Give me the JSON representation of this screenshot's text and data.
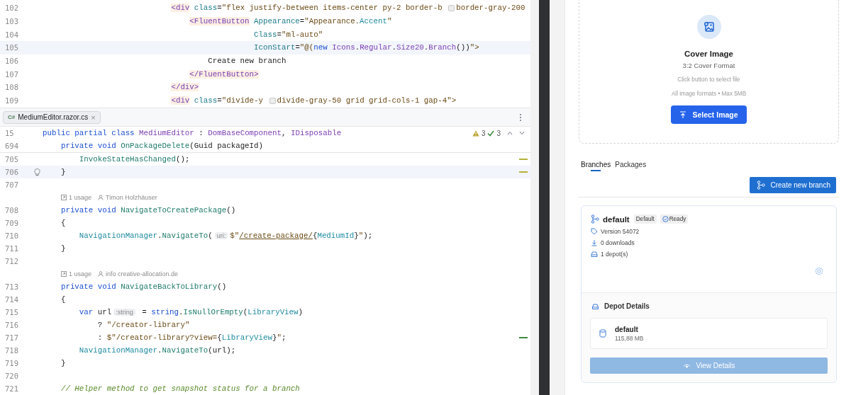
{
  "top_pane": {
    "lines": [
      {
        "number": "102",
        "current": false,
        "tokens": [
          {
            "kind": "tag",
            "text": "                            <div"
          },
          {
            "kind": "attr",
            "text": " class"
          },
          {
            "kind": "plain",
            "text": "="
          },
          {
            "kind": "str",
            "text": "\"flex justify-between items-center py-2 border-b "
          },
          {
            "kind": "swatch"
          },
          {
            "kind": "str",
            "text": "border-gray-200"
          }
        ]
      },
      {
        "number": "103",
        "current": false,
        "tokens": [
          {
            "kind": "tag",
            "text": "                                <FluentButton"
          },
          {
            "kind": "attr",
            "text": " Appearance"
          },
          {
            "kind": "plain",
            "text": "="
          },
          {
            "kind": "str",
            "text": "\"Appearance."
          },
          {
            "kind": "field",
            "text": "Accent"
          },
          {
            "kind": "str",
            "text": "\""
          }
        ]
      },
      {
        "number": "104",
        "current": false,
        "tokens": [
          {
            "kind": "attr",
            "text": "                                              Class"
          },
          {
            "kind": "plain",
            "text": "="
          },
          {
            "kind": "str",
            "text": "\"ml-auto\""
          }
        ]
      },
      {
        "number": "105",
        "current": true,
        "tokens": [
          {
            "kind": "attr",
            "text": "                                              IconStart"
          },
          {
            "kind": "plain",
            "text": "="
          },
          {
            "kind": "str",
            "text": "\"@("
          },
          {
            "kind": "kw",
            "text": "new "
          },
          {
            "kind": "type",
            "text": "Icons"
          },
          {
            "kind": "plain",
            "text": "."
          },
          {
            "kind": "type",
            "text": "Regular"
          },
          {
            "kind": "plain",
            "text": "."
          },
          {
            "kind": "type",
            "text": "Size20"
          },
          {
            "kind": "plain",
            "text": "."
          },
          {
            "kind": "type",
            "text": "Branch"
          },
          {
            "kind": "plain",
            "text": "())"
          },
          {
            "kind": "str",
            "text": "\">"
          }
        ]
      },
      {
        "number": "106",
        "current": false,
        "tokens": [
          {
            "kind": "plain",
            "text": "                                    Create new branch"
          }
        ]
      },
      {
        "number": "107",
        "current": false,
        "tokens": [
          {
            "kind": "tag",
            "text": "                                </FluentButton>"
          }
        ]
      },
      {
        "number": "108",
        "current": false,
        "tokens": [
          {
            "kind": "tag",
            "text": "                            </div>"
          }
        ]
      },
      {
        "number": "109",
        "current": false,
        "tokens": [
          {
            "kind": "tag",
            "text": "                            <div"
          },
          {
            "kind": "attr",
            "text": " class"
          },
          {
            "kind": "plain",
            "text": "="
          },
          {
            "kind": "str",
            "text": "\"divide-y "
          },
          {
            "kind": "swatch"
          },
          {
            "kind": "str",
            "text": "divide-gray-50 grid grid-cols-1 gap-4\">"
          }
        ]
      }
    ]
  },
  "editor_tab": {
    "lang": "C#",
    "label": "MediumEditor.razor.cs",
    "close": "×"
  },
  "inspections": {
    "warnings": "3",
    "passed": "3"
  },
  "sticky_lines": [
    {
      "number": "15",
      "tokens": [
        {
          "kind": "kw",
          "text": "public partial class "
        },
        {
          "kind": "type",
          "text": "MediumEditor"
        },
        {
          "kind": "plain",
          "text": " : "
        },
        {
          "kind": "type",
          "text": "DomBaseComponent"
        },
        {
          "kind": "plain",
          "text": ", "
        },
        {
          "kind": "type",
          "text": "IDisposable"
        }
      ]
    },
    {
      "number": "694",
      "tokens": [
        {
          "kind": "kw",
          "text": "    private void "
        },
        {
          "kind": "method",
          "text": "OnPackageDelete"
        },
        {
          "kind": "plain",
          "text": "(Guid packageId)"
        }
      ]
    }
  ],
  "lines": [
    {
      "kind": "code",
      "number": "705",
      "current": false,
      "lightbulb": false,
      "marker": {
        "color": "#b5b23a"
      },
      "tokens": [
        {
          "kind": "method",
          "text": "        InvokeStateHasChanged"
        },
        {
          "kind": "plain",
          "text": "();"
        }
      ]
    },
    {
      "kind": "code",
      "number": "706",
      "current": true,
      "lightbulb": true,
      "marker": {
        "color": "#b5b23a"
      },
      "tokens": [
        {
          "kind": "plain",
          "text": "    }"
        }
      ]
    },
    {
      "kind": "code",
      "number": "707",
      "current": false,
      "lightbulb": false
    },
    {
      "kind": "hint",
      "usages": "1 usage",
      "author": "Timon Holzhäuser"
    },
    {
      "kind": "code",
      "number": "708",
      "current": false,
      "lightbulb": false,
      "tokens": [
        {
          "kind": "kw",
          "text": "    private void "
        },
        {
          "kind": "method",
          "text": "NavigateToCreatePackage"
        },
        {
          "kind": "plain",
          "text": "()"
        }
      ]
    },
    {
      "kind": "code",
      "number": "709",
      "current": false,
      "lightbulb": false,
      "tokens": [
        {
          "kind": "plain",
          "text": "    {"
        }
      ]
    },
    {
      "kind": "code",
      "number": "710",
      "current": false,
      "lightbulb": false,
      "tokens": [
        {
          "kind": "field",
          "text": "        NavigationManager"
        },
        {
          "kind": "plain",
          "text": "."
        },
        {
          "kind": "method",
          "text": "NavigateTo"
        },
        {
          "kind": "plain",
          "text": "("
        },
        {
          "kind": "hint",
          "text": "uri:"
        },
        {
          "kind": "str",
          "text": "$\""
        },
        {
          "kind": "link",
          "text": "/create-package/"
        },
        {
          "kind": "plain",
          "text": "{"
        },
        {
          "kind": "field",
          "text": "MediumId"
        },
        {
          "kind": "plain",
          "text": "}"
        },
        {
          "kind": "str",
          "text": "\""
        },
        {
          "kind": "plain",
          "text": ");"
        }
      ]
    },
    {
      "kind": "code",
      "number": "711",
      "current": false,
      "lightbulb": false,
      "tokens": [
        {
          "kind": "plain",
          "text": "    }"
        }
      ]
    },
    {
      "kind": "code",
      "number": "712",
      "current": false,
      "lightbulb": false
    },
    {
      "kind": "hint",
      "usages": "1 usage",
      "author": "info creative-allocation.de"
    },
    {
      "kind": "code",
      "number": "713",
      "current": false,
      "lightbulb": false,
      "tokens": [
        {
          "kind": "kw",
          "text": "    private void "
        },
        {
          "kind": "method",
          "text": "NavigateBackToLibrary"
        },
        {
          "kind": "plain",
          "text": "()"
        }
      ]
    },
    {
      "kind": "code",
      "number": "714",
      "current": false,
      "lightbulb": false,
      "tokens": [
        {
          "kind": "plain",
          "text": "    {"
        }
      ]
    },
    {
      "kind": "code",
      "number": "715",
      "current": false,
      "lightbulb": false,
      "tokens": [
        {
          "kind": "kw",
          "text": "        var "
        },
        {
          "kind": "plain",
          "text": "url"
        },
        {
          "kind": "hint",
          "text": ":string"
        },
        {
          "kind": "plain",
          "text": " = "
        },
        {
          "kind": "kw",
          "text": "string"
        },
        {
          "kind": "plain",
          "text": "."
        },
        {
          "kind": "method",
          "text": "IsNullOrEmpty"
        },
        {
          "kind": "plain",
          "text": "("
        },
        {
          "kind": "field",
          "text": "LibraryView"
        },
        {
          "kind": "plain",
          "text": ")"
        }
      ]
    },
    {
      "kind": "code",
      "number": "716",
      "current": false,
      "lightbulb": false,
      "tokens": [
        {
          "kind": "plain",
          "text": "            ? "
        },
        {
          "kind": "str",
          "text": "\"/creator-library\""
        }
      ]
    },
    {
      "kind": "code",
      "number": "717",
      "current": false,
      "lightbulb": false,
      "marker": {
        "color": "#3c8a3c"
      },
      "tokens": [
        {
          "kind": "plain",
          "text": "            : "
        },
        {
          "kind": "str",
          "text": "$\"/creator-library?view="
        },
        {
          "kind": "plain",
          "text": "{"
        },
        {
          "kind": "field",
          "text": "LibraryView"
        },
        {
          "kind": "plain",
          "text": "}"
        },
        {
          "kind": "str",
          "text": "\""
        },
        {
          "kind": "plain",
          "text": ";"
        }
      ]
    },
    {
      "kind": "code",
      "number": "718",
      "current": false,
      "lightbulb": false,
      "tokens": [
        {
          "kind": "field",
          "text": "        NavigationManager"
        },
        {
          "kind": "plain",
          "text": "."
        },
        {
          "kind": "method",
          "text": "NavigateTo"
        },
        {
          "kind": "plain",
          "text": "(url);"
        }
      ]
    },
    {
      "kind": "code",
      "number": "719",
      "current": false,
      "lightbulb": false,
      "tokens": [
        {
          "kind": "plain",
          "text": "    }"
        }
      ]
    },
    {
      "kind": "code",
      "number": "720",
      "current": false,
      "lightbulb": false
    },
    {
      "kind": "code",
      "number": "721",
      "current": false,
      "lightbulb": false,
      "tokens": [
        {
          "kind": "comment",
          "text": "    // Helper method to get snapshot status for a branch"
        }
      ]
    }
  ],
  "cover_upload": {
    "title": "Cover Image",
    "subtitle": "3:2 Cover Format",
    "hint": "Click button to select file",
    "formats": "All image formats • Max 5MB",
    "button": "Select Image"
  },
  "tabs": [
    {
      "label": "Branches",
      "selected": true
    },
    {
      "label": "Packages",
      "selected": false
    }
  ],
  "create_button": "Create new branch",
  "branch": {
    "name": "default",
    "badges": [
      {
        "label": "Default",
        "kind": "plain"
      },
      {
        "label": "Ready",
        "kind": "status"
      }
    ],
    "meta": [
      {
        "kind": "tag",
        "text": "Version 54072"
      },
      {
        "kind": "download",
        "text": "0 downloads"
      },
      {
        "kind": "drive",
        "text": "1 depot(s)"
      }
    ],
    "depot_title": "Depot Details",
    "depots": [
      {
        "name": "default",
        "size": "115,88 MB"
      }
    ],
    "view_button": {
      "label": "View Details",
      "disabled": true
    }
  }
}
